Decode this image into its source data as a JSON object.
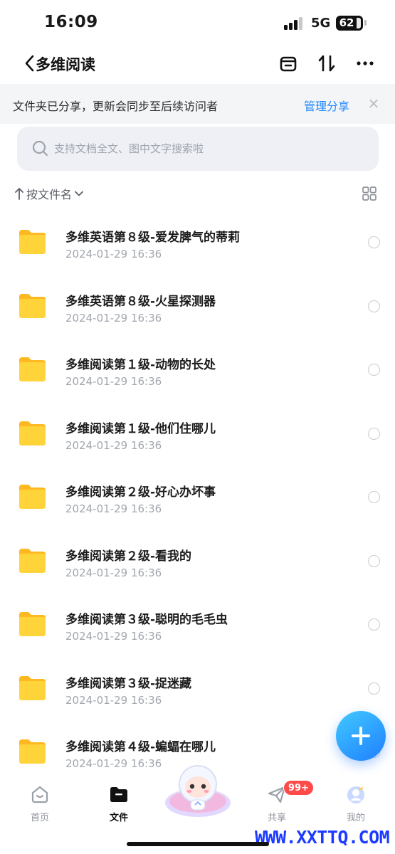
{
  "status_bar": {
    "time": "16:09",
    "network": "5G",
    "battery": "62"
  },
  "nav": {
    "title": "多维阅读"
  },
  "banner": {
    "text": "文件夹已分享，更新会同步至后续访问者",
    "link": "管理分享",
    "close": "×"
  },
  "search": {
    "placeholder": "支持文档全文、图中文字搜索啦"
  },
  "sort": {
    "label": "按文件名"
  },
  "files": [
    {
      "name": "多维英语第８级-爱发脾气的蒂莉",
      "date": "2024-01-29 16:36"
    },
    {
      "name": "多维英语第８级-火星探测器",
      "date": "2024-01-29 16:36"
    },
    {
      "name": "多维阅读第１级-动物的长处",
      "date": "2024-01-29 16:36"
    },
    {
      "name": "多维阅读第１级-他们住哪儿",
      "date": "2024-01-29 16:36"
    },
    {
      "name": "多维阅读第２级-好心办坏事",
      "date": "2024-01-29 16:36"
    },
    {
      "name": "多维阅读第２级-看我的",
      "date": "2024-01-29 16:36"
    },
    {
      "name": "多维阅读第３级-聪明的毛毛虫",
      "date": "2024-01-29 16:36"
    },
    {
      "name": "多维阅读第３级-捉迷藏",
      "date": "2024-01-29 16:36"
    },
    {
      "name": "多维阅读第４级-蝙蝠在哪儿",
      "date": "2024-01-29 16:36"
    }
  ],
  "tabs": [
    {
      "label": "首页",
      "icon": "home-icon"
    },
    {
      "label": "文件",
      "icon": "folder-icon",
      "active": true
    },
    {
      "label": "",
      "icon": "mascot-icon"
    },
    {
      "label": "共享",
      "icon": "paper-plane-icon",
      "badge": "99+"
    },
    {
      "label": "我的",
      "icon": "avatar-icon"
    }
  ],
  "watermark": "WWW.XXTTQ.COM",
  "colors": {
    "accent": "#1e88ff",
    "folder": "#ffcc2e",
    "badge": "#ff4a4a"
  }
}
